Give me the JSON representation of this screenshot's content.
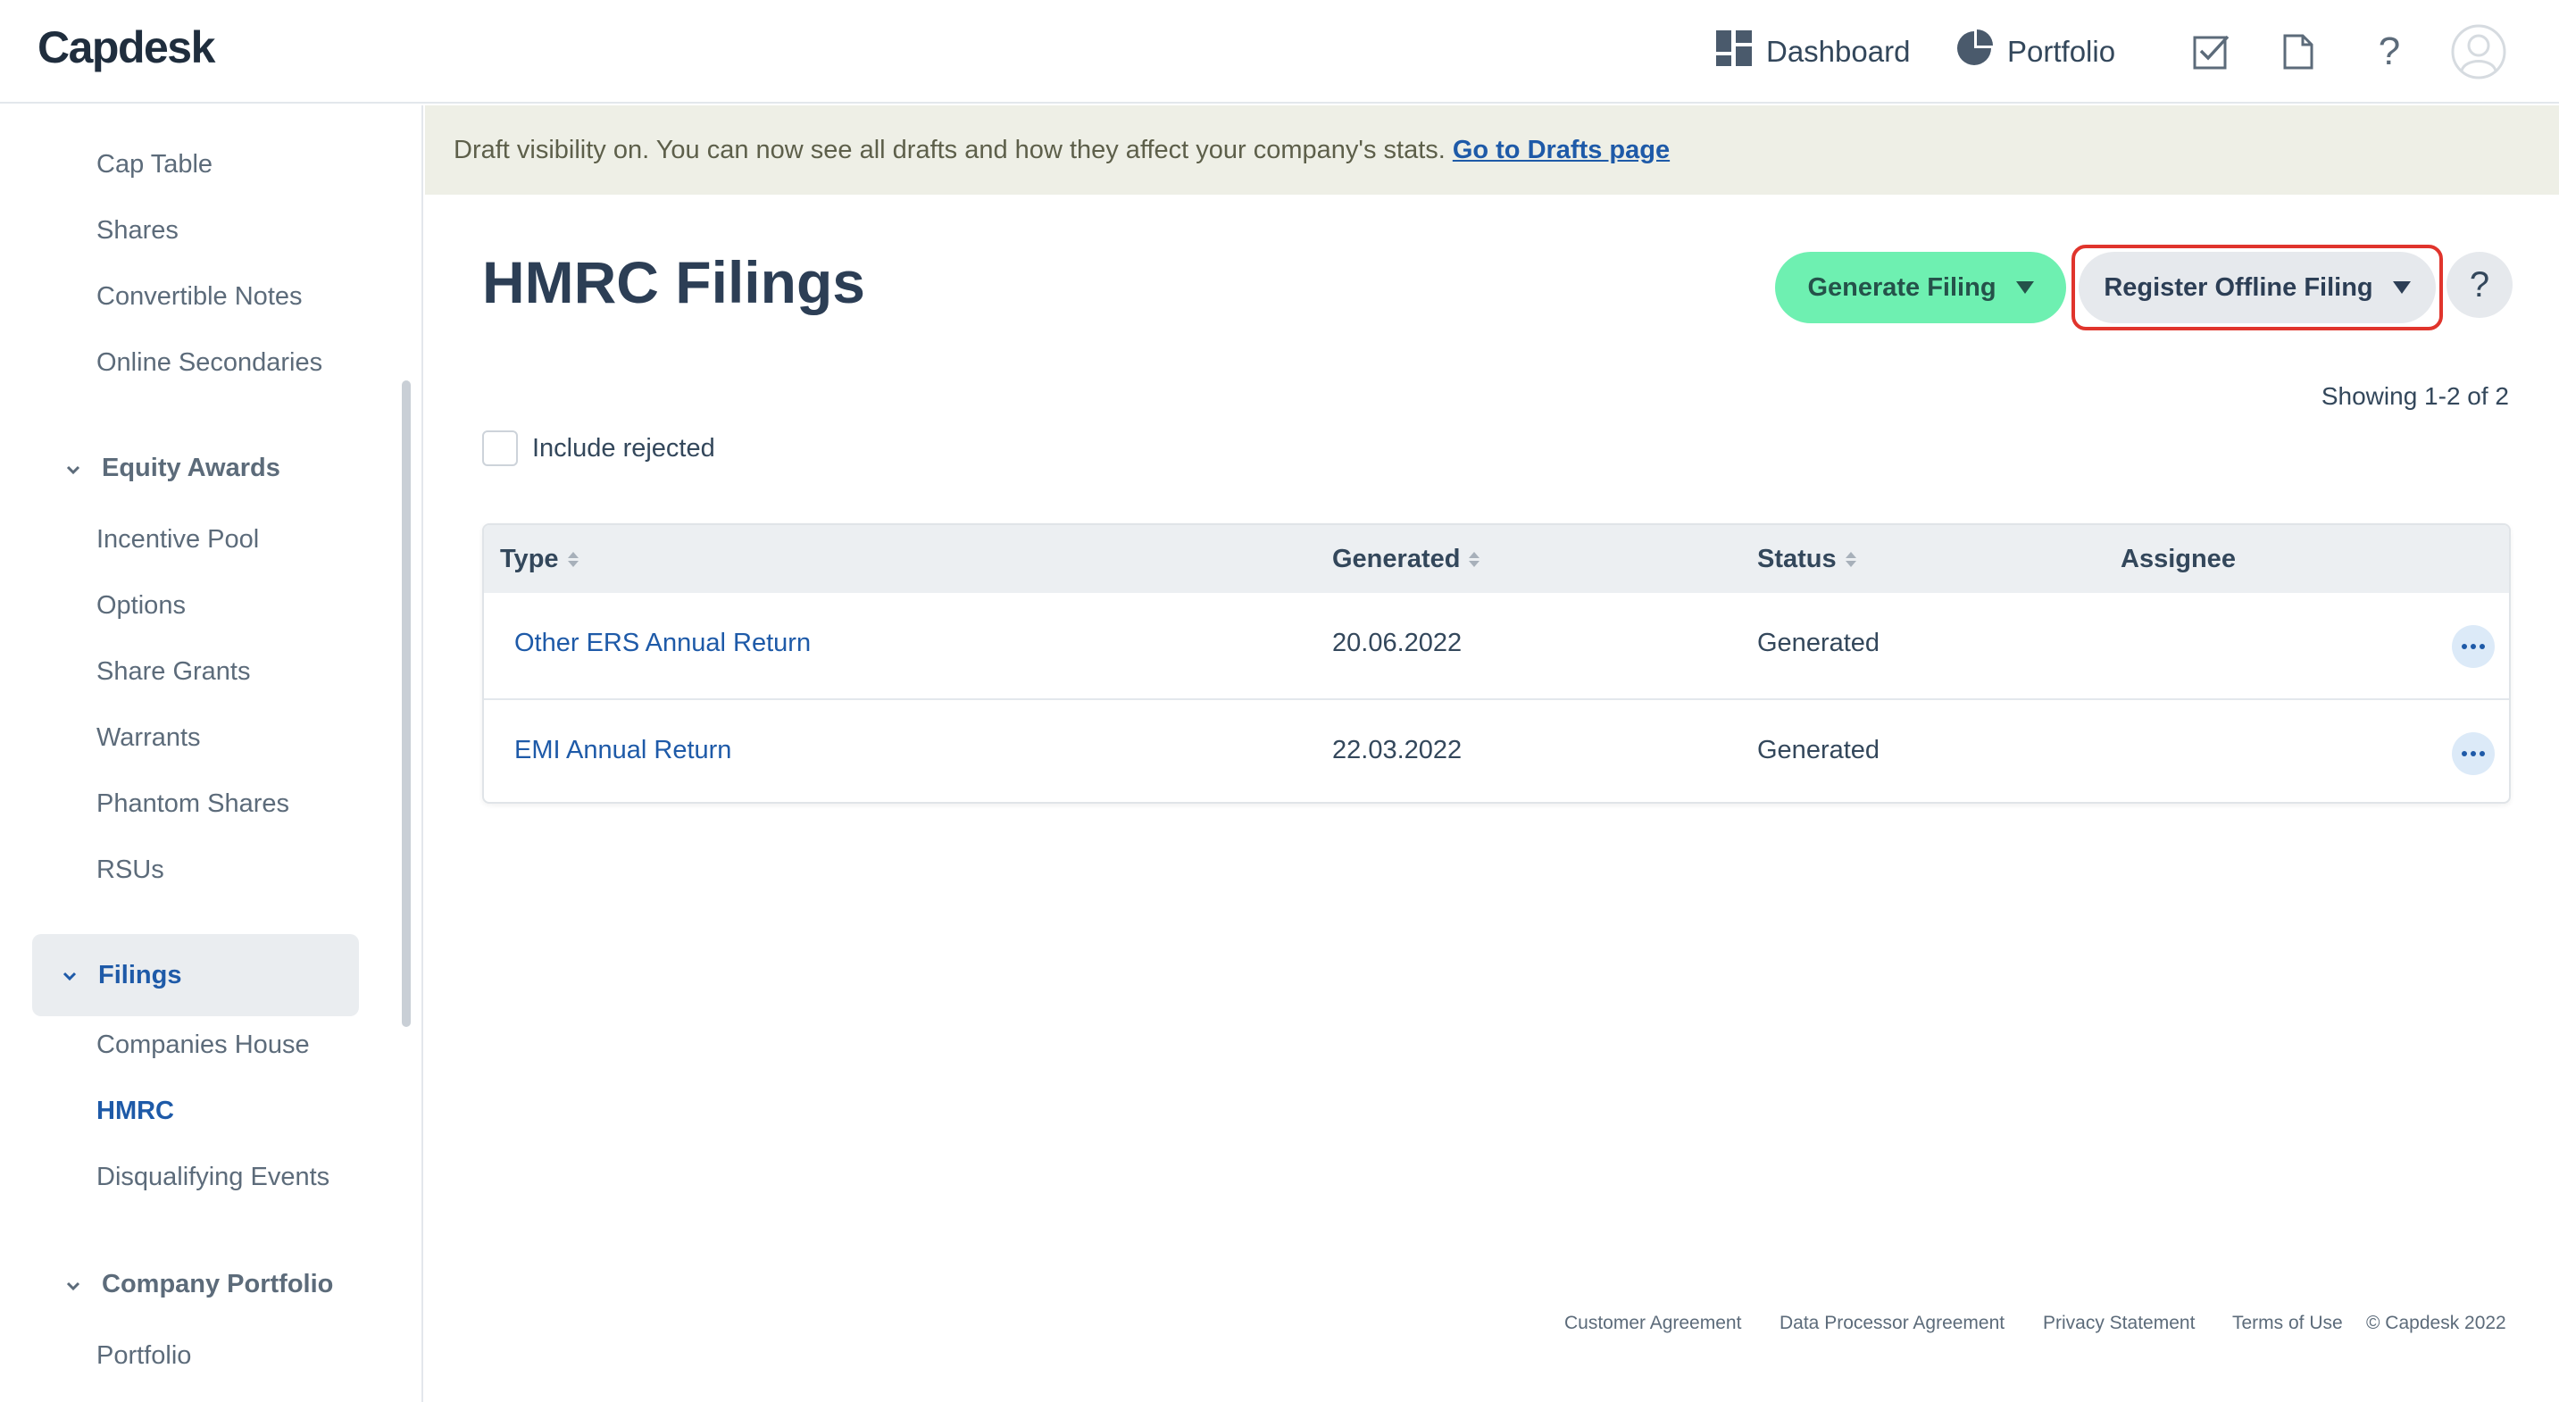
{
  "app": {
    "logo": "Capdesk"
  },
  "topnav": {
    "dashboard": "Dashboard",
    "portfolio": "Portfolio",
    "icons": [
      "tasks-icon",
      "document-icon",
      "help-icon",
      "avatar-icon"
    ]
  },
  "sidebar": {
    "items": [
      {
        "label": "Cap Table"
      },
      {
        "label": "Shares"
      },
      {
        "label": "Convertible Notes"
      },
      {
        "label": "Online Secondaries"
      }
    ],
    "groups": [
      {
        "label": "Equity Awards",
        "items": [
          "Incentive Pool",
          "Options",
          "Share Grants",
          "Warrants",
          "Phantom Shares",
          "RSUs"
        ]
      },
      {
        "label": "Filings",
        "items": [
          "Companies House",
          "HMRC",
          "Disqualifying Events"
        ]
      },
      {
        "label": "Company Portfolio",
        "items": [
          "Portfolio"
        ]
      }
    ],
    "active_item": "HMRC"
  },
  "banner": {
    "text": "Draft visibility on. You can now see all drafts and how they affect your company's stats.",
    "link": "Go to Drafts page"
  },
  "main": {
    "title": "HMRC Filings",
    "generate_button": "Generate Filing",
    "register_button": "Register Offline Filing",
    "help_button": "?",
    "showing": "Showing 1-2 of 2",
    "include_rejected": "Include rejected"
  },
  "table": {
    "headers": [
      "Type",
      "Generated",
      "Status",
      "Assignee"
    ],
    "rows": [
      {
        "type": "Other ERS Annual Return",
        "generated": "20.06.2022",
        "status": "Generated",
        "assignee": ""
      },
      {
        "type": "EMI Annual Return",
        "generated": "22.03.2022",
        "status": "Generated",
        "assignee": ""
      }
    ]
  },
  "footer": {
    "links": [
      "Customer Agreement",
      "Data Processor Agreement",
      "Privacy Statement",
      "Terms of Use"
    ],
    "copyright": "© Capdesk 2022"
  },
  "colors": {
    "accent_blue": "#1e5aa8",
    "generate_green": "#6ef0b1",
    "highlight_red": "#e0342c",
    "banner_bg": "#eeefe6"
  }
}
